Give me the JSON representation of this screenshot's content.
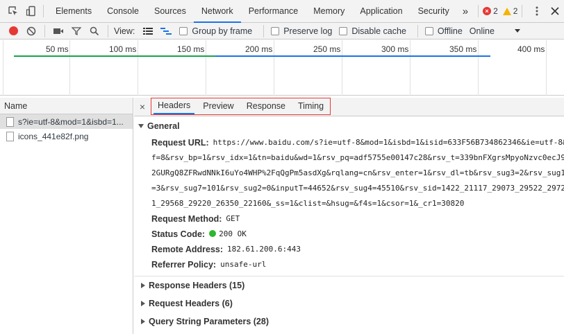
{
  "tabs": [
    "Elements",
    "Console",
    "Sources",
    "Network",
    "Performance",
    "Memory",
    "Application",
    "Security"
  ],
  "active_tab": "Network",
  "overflow_glyph": "»",
  "errors": {
    "error_count": "2",
    "warning_count": "2"
  },
  "toolbar": {
    "view_label": "View:",
    "group_by_frame": "Group by frame",
    "preserve_log": "Preserve log",
    "disable_cache": "Disable cache",
    "offline": "Offline",
    "online": "Online"
  },
  "timeline": {
    "ticks": [
      "50 ms",
      "100 ms",
      "150 ms",
      "200 ms",
      "250 ms",
      "300 ms",
      "350 ms",
      "400 ms"
    ]
  },
  "requests": {
    "header": "Name",
    "items": [
      "s?ie=utf-8&mod=1&isbd=1...",
      "icons_441e82f.png"
    ]
  },
  "detail": {
    "close_glyph": "×",
    "tabs": [
      "Headers",
      "Preview",
      "Response",
      "Timing"
    ],
    "active_tab": "Headers",
    "general": {
      "title": "General",
      "request_url_key": "Request URL:",
      "request_url_lines": [
        "https://www.baidu.com/s?ie=utf-8&mod=1&isbd=1&isid=633F56B734862346&ie=utf-8&",
        "f=8&rsv_bp=1&rsv_idx=1&tn=baidu&wd=1&rsv_pq=adf5755e00147c28&rsv_t=339bnFXgrsMpyoNzvc0ecJ9",
        "2GURgQ8ZFRwdNNkI6uYo4WHP%2FqQgPm5asdXg&rqlang=cn&rsv_enter=1&rsv_dl=tb&rsv_sug3=2&rsv_sug1",
        "=3&rsv_sug7=101&rsv_sug2=0&inputT=44652&rsv_sug4=45510&rsv_sid=1422_21117_29073_29522_2972",
        "1_29568_29220_26350_22160&_ss=1&clist=&hsug=&f4s=1&csor=1&_cr1=30820"
      ],
      "request_method_key": "Request Method:",
      "request_method": "GET",
      "status_code_key": "Status Code:",
      "status_code": "200 OK",
      "remote_address_key": "Remote Address:",
      "remote_address": "182.61.200.6:443",
      "referrer_policy_key": "Referrer Policy:",
      "referrer_policy": "unsafe-url"
    },
    "response_headers": "Response Headers (15)",
    "request_headers": "Request Headers (6)",
    "query_string": "Query String Parameters (28)"
  },
  "colors": {
    "accent": "#1a73e8",
    "record_red": "#e53935",
    "status_green": "#2fb62f",
    "highlight_box": "#e53935"
  }
}
